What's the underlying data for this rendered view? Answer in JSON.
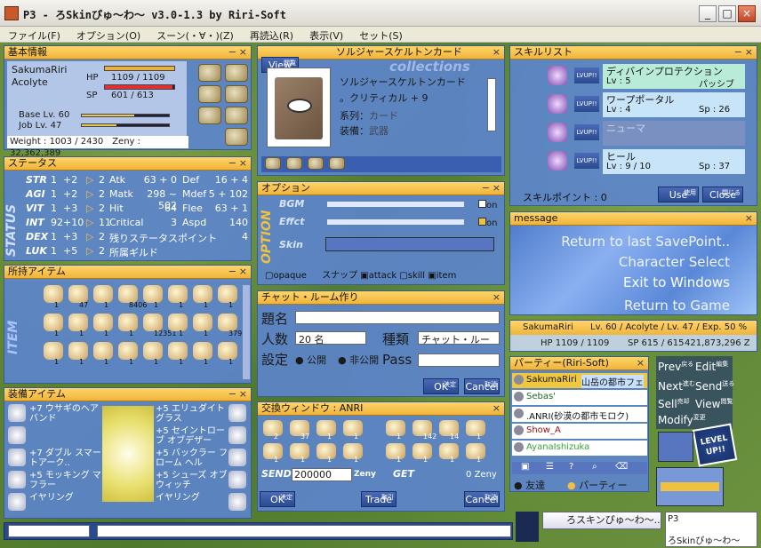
{
  "window": {
    "title": "P3 - ろSkinぴゅ～わ～ v3.0-1.3 by Riri-Soft",
    "min": "_",
    "max": "□",
    "close": "×"
  },
  "menu": [
    "ファイル(F)",
    "オプション(O)",
    "スーン(・∀・)(Z)",
    "再読込(R)",
    "表示(V)",
    "セット(S)"
  ],
  "basic": {
    "header": "基本情報",
    "name": "SakumaRiri",
    "job": "Acolyte",
    "hp_label": "HP",
    "hp": "1109 / 1109",
    "sp_label": "SP",
    "sp": "601 / 613",
    "base": "Base Lv. 60",
    "joblv": "Job Lv. 47",
    "weight": "Weight : 1003 / 2430",
    "zeny": "Zeny : 32,362,389",
    "hp_fill": 1.0,
    "sp_fill": 0.98
  },
  "card": {
    "view": "View",
    "view_sub": "閲覧",
    "name": "ソルジャースケルトンカード",
    "title": "ソルジャースケルトンカード",
    "effect": "。クリティカル + 9",
    "kind_label": "系列：",
    "kind": "カード",
    "equip_label": "装備：",
    "equip": "武器",
    "collections": "collections"
  },
  "skills": {
    "header": "スキルリスト",
    "items": [
      {
        "name": "ディバインプロテクション",
        "lv": "Lv : 5",
        "extra": "パッシブ"
      },
      {
        "name": "ワープポータル",
        "lv": "Lv : 4",
        "extra": "Sp : 26"
      },
      {
        "name": "ニューマ",
        "lv": "",
        "extra": ""
      },
      {
        "name": "ヒール",
        "lv": "Lv : 9 / 10",
        "extra": "Sp : 37"
      }
    ],
    "points": "スキルポイント : 0",
    "use": "Use",
    "use_sub": "使用",
    "close": "Close",
    "close_sub": "閉じる",
    "lvup": "LVUP!!"
  },
  "status": {
    "header": "ステータス",
    "side": "STATUS",
    "tabs": [
      "Skill",
      "Status"
    ],
    "rows": [
      {
        "k": "STR",
        "v": "1",
        "b": "+2",
        "p": "2",
        "a": "Atk",
        "av": "63 + 0",
        "d": "Def",
        "dv": "16 + 4"
      },
      {
        "k": "AGI",
        "v": "1",
        "b": "+2",
        "p": "2",
        "a": "Matk",
        "av": "298 ~ 502",
        "d": "Mdef",
        "dv": "5 + 102"
      },
      {
        "k": "VIT",
        "v": "1",
        "b": "+3",
        "p": "2",
        "a": "Hit",
        "av": "64",
        "d": "Flee",
        "dv": "63 + 1"
      },
      {
        "k": "INT",
        "v": "92",
        "b": "+10",
        "p": "11",
        "a": "Critical",
        "av": "3",
        "d": "Aspd",
        "dv": "140"
      },
      {
        "k": "DEX",
        "v": "1",
        "b": "+3",
        "p": "2",
        "a": "残りステータスポイント",
        "av": "",
        "d": "",
        "dv": "4"
      },
      {
        "k": "LUK",
        "v": "1",
        "b": "+5",
        "p": "2",
        "a": "所属ギルド",
        "av": "",
        "d": "",
        "dv": ""
      }
    ]
  },
  "options": {
    "header": "オプション",
    "side": "OPTION",
    "bgm": "BGM",
    "effect": "Effct",
    "skin": "Skin",
    "on": "on",
    "opaque": "opaque",
    "snap": "スナップ",
    "attack": "attack",
    "skill": "skill",
    "item": "item"
  },
  "message": {
    "header": "message",
    "menu": [
      "Return to last SavePoint..",
      "Character Select",
      "Exit to Windows",
      "Return to Game"
    ]
  },
  "items": {
    "header": "所持アイテム",
    "side": "ITEM",
    "tabs": [
      "etc",
      "Equip",
      "Item"
    ],
    "qty": [
      "1",
      "47",
      "1",
      "8406",
      "1",
      "1",
      "1",
      "1",
      "1",
      "1",
      "1",
      "1",
      "12351",
      "1",
      "1",
      "379",
      "1",
      "1",
      "1",
      "1",
      "1",
      "1",
      "1",
      "1"
    ]
  },
  "chat": {
    "header": "チャット・ルーム作り",
    "title_label": "題名",
    "people_label": "人数",
    "people": "20 名",
    "kind_label": "種類",
    "kind": "チャット・ルー",
    "setting_label": "設定",
    "public": "公開",
    "private": "非公開",
    "pass": "Pass",
    "ok": "OK",
    "ok_sub": "決定",
    "cancel": "Cancel",
    "cancel_sub": "取消"
  },
  "info": {
    "name": "SakumaRiri",
    "line": "Lv. 60 / Acolyte / Lv. 47 / Exp. 50 %",
    "hp": "HP  1109 / 1109",
    "sp": "SP  615 / 615",
    "zeny": "421,873,296 Z"
  },
  "party": {
    "header": "パーティー(Riri-Soft)",
    "members": [
      {
        "n": "SakumaRiri",
        "m": "山岳の都市フェ"
      },
      {
        "n": "Sebas'",
        "m": ""
      },
      {
        "n": ".ANRI(砂漠の都市モロク)",
        "m": ""
      },
      {
        "n": "Show_A",
        "m": ""
      },
      {
        "n": "AyanaIshizuka",
        "m": ""
      }
    ],
    "friend": "友達",
    "party": "パーティー",
    "off": "off"
  },
  "equip": {
    "header": "装備アイテム",
    "left": [
      "+7 ウサギのヘアバンド",
      "",
      "+7 ダブル スマートアーク..",
      "+5 モッキング マフラー",
      "イヤリング"
    ],
    "right": [
      "+5 エリュダイト グラス",
      "+5 セイントローブ オブデザー",
      "+5 バックラー フローム ヘル",
      "+5 シューズ オブ ウィッチ",
      "イヤリング"
    ]
  },
  "trade": {
    "header": "交換ウィンドウ : ANRI",
    "send": "SEND",
    "send_val": "200000",
    "zeny": "Zeny",
    "get": "GET",
    "get_val": "0",
    "ok": "OK",
    "ok_sub": "決定",
    "trade": "Trade",
    "trade_sub": "取引",
    "cancel": "Cancel",
    "cancel_sub": "取消",
    "qty": [
      "2",
      "37",
      "1",
      "1",
      "1",
      "1",
      "1",
      "1",
      "1",
      "142",
      "14",
      "1",
      "1",
      "1",
      "1",
      "1"
    ]
  },
  "nav": {
    "prev": "Prev",
    "prev_sub": "戻る",
    "edit": "Edit",
    "edit_sub": "編集",
    "next": "Next",
    "next_sub": "進む",
    "send": "Send",
    "send_sub": "送る",
    "sell": "Sell",
    "sell_sub": "売却",
    "view": "View",
    "view_sub": "閲覧",
    "modify": "Modify",
    "modify_sub": "変更",
    "levelup": "LEVEL UP!!"
  },
  "bottom": {
    "skin": "ろスキンぴゅ～わ～..",
    "p3": "P3",
    "tag": "ろSkinぴゅ～わ～"
  }
}
